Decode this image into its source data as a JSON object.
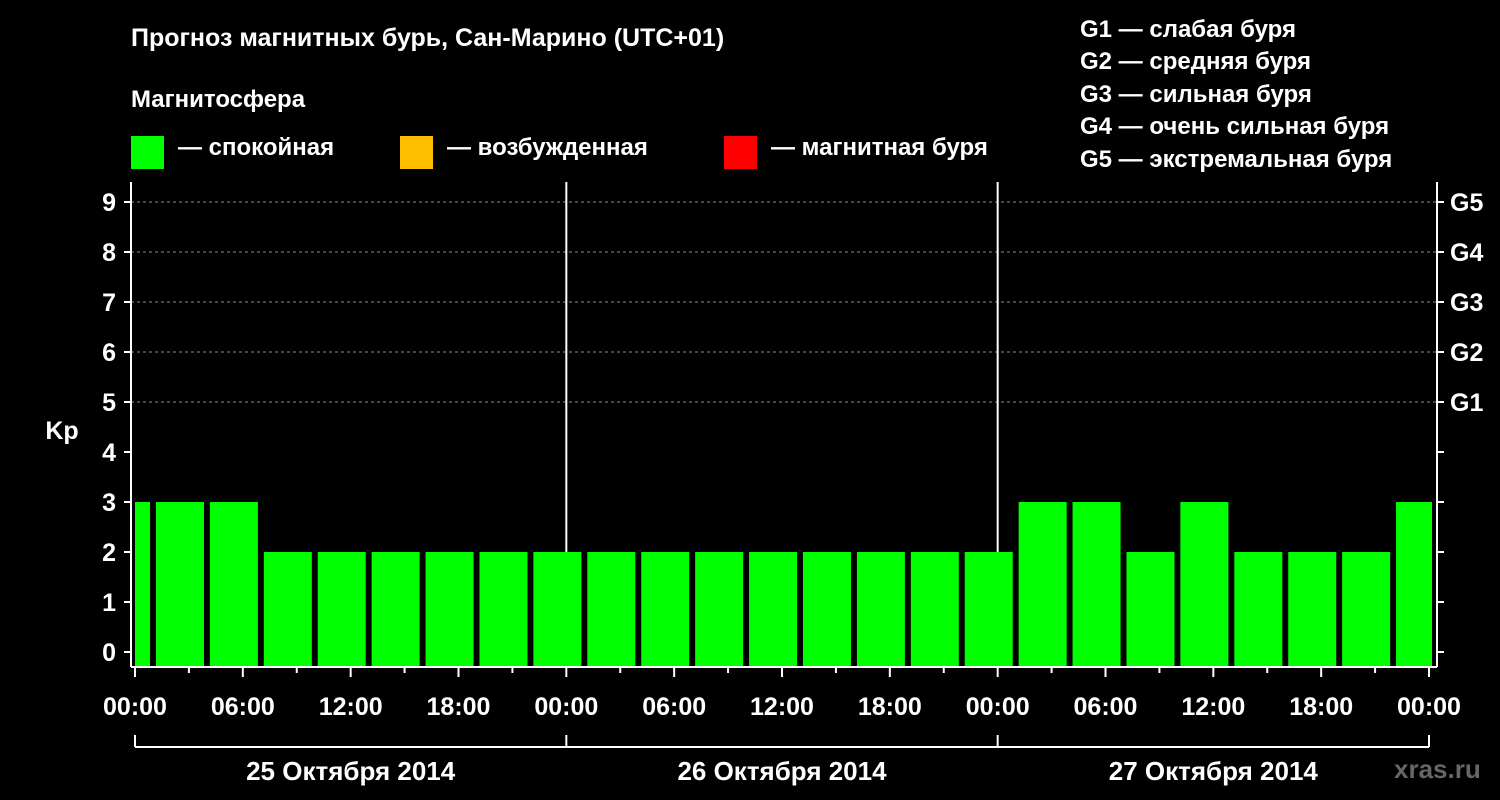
{
  "header": {
    "title": "Прогноз магнитных бурь, Сан-Марино (UTC+01)",
    "subtitle": "Магнитосфера"
  },
  "legend": [
    {
      "label": "— спокойная",
      "color": "#00ff00"
    },
    {
      "label": "— возбужденная",
      "color": "#ffbf00"
    },
    {
      "label": "— магнитная буря",
      "color": "#ff0000"
    }
  ],
  "g_scale": [
    "G1 — слабая буря",
    "G2 — средняя буря",
    "G3 — сильная буря",
    "G4 — очень сильная буря",
    "G5 — экстремальная буря"
  ],
  "watermark": "xras.ru",
  "chart_data": {
    "type": "bar",
    "title": "Прогноз магнитных бурь, Сан-Марино (UTC+01)",
    "ylabel": "Kp",
    "ylim": [
      0,
      9
    ],
    "yticks": [
      "0",
      "1",
      "2",
      "3",
      "4",
      "5",
      "6",
      "7",
      "8",
      "9"
    ],
    "right_axis_labels": [
      {
        "kp": 5,
        "label": "G1"
      },
      {
        "kp": 6,
        "label": "G2"
      },
      {
        "kp": 7,
        "label": "G3"
      },
      {
        "kp": 8,
        "label": "G4"
      },
      {
        "kp": 9,
        "label": "G5"
      }
    ],
    "grid": "horizontal dashed",
    "xticks": [
      "00:00",
      "06:00",
      "12:00",
      "18:00",
      "00:00",
      "06:00",
      "12:00",
      "18:00",
      "00:00",
      "06:00",
      "12:00",
      "18:00",
      "00:00"
    ],
    "days": [
      "25 Октября 2014",
      "26 Октября 2014",
      "27 Октября 2014"
    ],
    "interval_hours": 3,
    "first_bar_start_hour": -2,
    "values": [
      3,
      3,
      3,
      2,
      2,
      2,
      2,
      2,
      2,
      2,
      2,
      2,
      2,
      2,
      2,
      2,
      2,
      3,
      3,
      2,
      3,
      2,
      2,
      2,
      3
    ],
    "bar_color": "#00ff00"
  }
}
